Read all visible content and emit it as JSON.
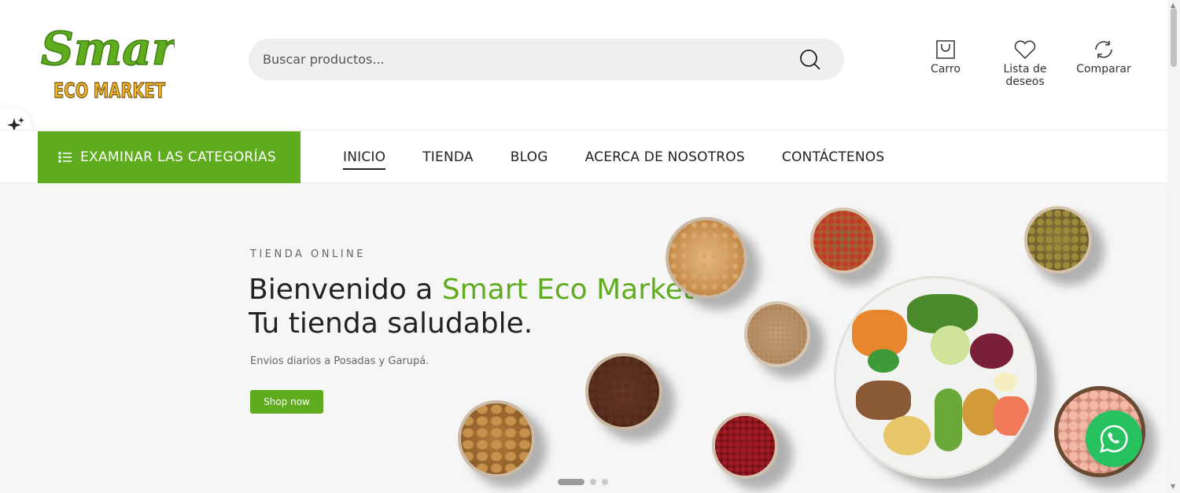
{
  "brand": {
    "logo_top": "Smart",
    "logo_bottom": "ECO MARKET"
  },
  "search": {
    "placeholder": "Buscar productos..."
  },
  "header_actions": [
    {
      "label": "Carro",
      "icon": "shopping-bag-icon"
    },
    {
      "label": "Lista de deseos",
      "icon": "heart-icon"
    },
    {
      "label": "Comparar",
      "icon": "compare-arrows-icon"
    }
  ],
  "nav": {
    "categories_label": "EXAMINAR LAS CATEGORÍAS",
    "items": [
      "INICIO",
      "TIENDA",
      "BLOG",
      "ACERCA DE NOSOTROS",
      "CONTÁCTENOS"
    ],
    "active": "INICIO"
  },
  "hero": {
    "eyebrow": "TIENDA ONLINE",
    "title_prefix": "Bienvenido a ",
    "title_highlight": "Smart Eco Market",
    "title_line2": "Tu tienda saludable.",
    "subtitle": "Envios diarios a Posadas y Garupá.",
    "cta": "Shop now",
    "slides_total": 3,
    "slide_active": 1
  },
  "colors": {
    "accent": "#5fad1f",
    "whatsapp": "#27c15f",
    "logo_yellow": "#f0b62b"
  },
  "floating": {
    "whatsapp_icon": "whatsapp-icon",
    "ai_icon": "sparkles-icon"
  }
}
